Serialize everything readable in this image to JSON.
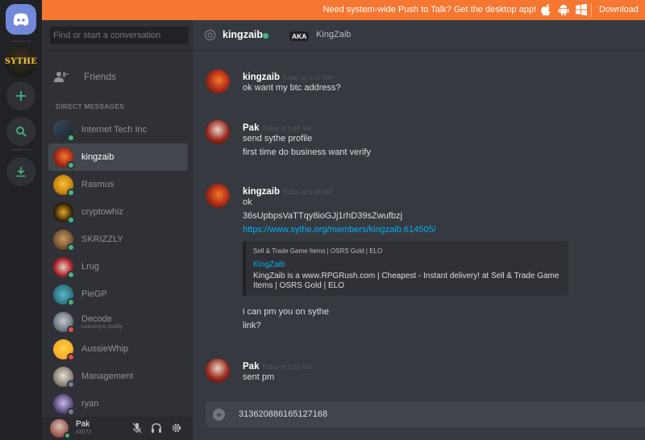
{
  "banner": {
    "message": "Need system-wide Push to Talk? Get the desktop app!",
    "download_label": "Download",
    "icons": [
      "apple-icon",
      "android-icon",
      "windows-icon"
    ]
  },
  "guilds": {
    "server_label": "SYTHE",
    "icons": [
      "discord-logo-icon",
      "add-server-icon",
      "search-servers-icon",
      "download-apps-icon"
    ]
  },
  "sidebar": {
    "search_placeholder": "Find or start a conversation",
    "friends_label": "Friends",
    "dm_header": "DIRECT MESSAGES",
    "dms": [
      {
        "name": "Internet Tech Inc",
        "status": "online",
        "avatar": "av-itech",
        "activity": ""
      },
      {
        "name": "kingzaib",
        "status": "online",
        "avatar": "av-kz",
        "activity": "",
        "active": true
      },
      {
        "name": "Rasmus",
        "status": "online",
        "avatar": "av-rasmus",
        "activity": ""
      },
      {
        "name": "cryptowhiz",
        "status": "online",
        "avatar": "av-crypto",
        "activity": ""
      },
      {
        "name": "SKRIZZLY",
        "status": "online",
        "avatar": "av-skrizzly",
        "activity": ""
      },
      {
        "name": "Lrug",
        "status": "online",
        "avatar": "av-lrug",
        "activity": ""
      },
      {
        "name": "PieGP",
        "status": "online",
        "avatar": "av-piegp",
        "activity": ""
      },
      {
        "name": "Decode",
        "status": "dnd",
        "avatar": "av-decode",
        "activity": "Listening to Spotify"
      },
      {
        "name": "AussieWhip",
        "status": "dnd",
        "avatar": "av-aussie",
        "activity": ""
      },
      {
        "name": "Management",
        "status": "offline",
        "avatar": "av-mgmt",
        "activity": ""
      },
      {
        "name": "ryan",
        "status": "offline",
        "avatar": "av-ryan",
        "activity": ""
      }
    ]
  },
  "user": {
    "name": "Pak",
    "tag": "#3072",
    "status": "online"
  },
  "colors": {
    "banner": "#f57731",
    "online": "#43b581",
    "dnd": "#f04747",
    "offline": "#747f8d",
    "link": "#00b0f4"
  },
  "channel": {
    "title": "kingzaib",
    "aka_badge": "AKA",
    "aka_name": "KingZaib"
  },
  "messages": [
    {
      "author": "kingzaib",
      "time": "Today at 5:47 AM",
      "lines": [
        "ok want my btc address?"
      ]
    },
    {
      "author": "Pak",
      "time": "Today at 5:48 AM",
      "lines": [
        "send sythe profile",
        "first time do business want verify"
      ]
    },
    {
      "author": "kingzaib",
      "time": "Today at 5:48 AM",
      "lines": [
        "ok",
        "36sUpbpsVaTTqy8ioGJj1rhD39sZwufbzj"
      ],
      "link": "https://www.sythe.org/members/kingzaib.614505/",
      "embed": {
        "provider": "Sell & Trade Game Items | OSRS Gold | ELO",
        "title": "KingZaib",
        "description": "KingZaib is a www.RPGRush.com | Cheapest - Instant delivery! at Sell & Trade Game Items | OSRS Gold | ELO"
      },
      "after_lines": [
        "i can pm you on sythe",
        "link?"
      ]
    },
    {
      "author": "Pak",
      "time": "Today at 5:52 AM",
      "lines": [
        "sent pm"
      ]
    }
  ],
  "composer": {
    "value": "313620886165127168"
  }
}
